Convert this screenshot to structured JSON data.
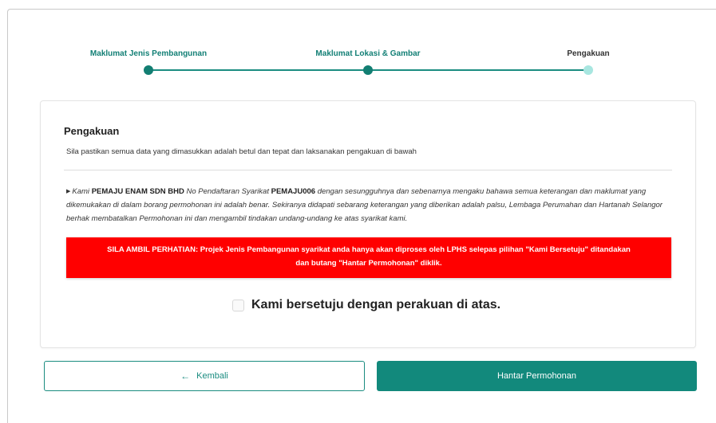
{
  "stepper": {
    "steps": [
      {
        "label": "Maklumat Jenis Pembangunan"
      },
      {
        "label": "Maklumat Lokasi & Gambar"
      },
      {
        "label": "Pengakuan"
      }
    ],
    "current_step": 3
  },
  "declaration": {
    "title": "Pengakuan",
    "subtitle": "Sila pastikan semua data yang dimasukkan adalah betul dan tepat dan laksanakan pengakuan di bawah",
    "statement": {
      "prefix": "Kami ",
      "company_name": "PEMAJU ENAM SDN BHD",
      "reg_label": " No Pendaftaran Syarikat ",
      "reg_no": "PEMAJU006",
      "body": " dengan sesungguhnya dan sebenarnya mengaku bahawa semua keterangan dan maklumat yang dikemukakan di dalam borang permohonan ini adalah benar. Sekiranya didapati sebarang keterangan yang diberikan adalah palsu, Lembaga Perumahan dan Hartanah Selangor berhak membatalkan Permohonan ini dan mengambil tindakan undang-undang ke atas syarikat kami."
    },
    "alert_line1": "SILA AMBIL PERHATIAN: Projek Jenis Pembangunan syarikat anda hanya akan diproses oleh LPHS selepas pilihan \"Kami Bersetuju\" ditandakan",
    "alert_line2": "dan butang \"Hantar Permohonan\" diklik.",
    "agree_label": "Kami bersetuju dengan perakuan di atas.",
    "agree_checked": false
  },
  "actions": {
    "back_icon": "arrow-left-icon",
    "back_label": "Kembali",
    "submit_label": "Hantar Permohonan"
  },
  "colors": {
    "primary": "#12897c",
    "step_current": "#a8e6e0",
    "alert": "#ff0000"
  }
}
